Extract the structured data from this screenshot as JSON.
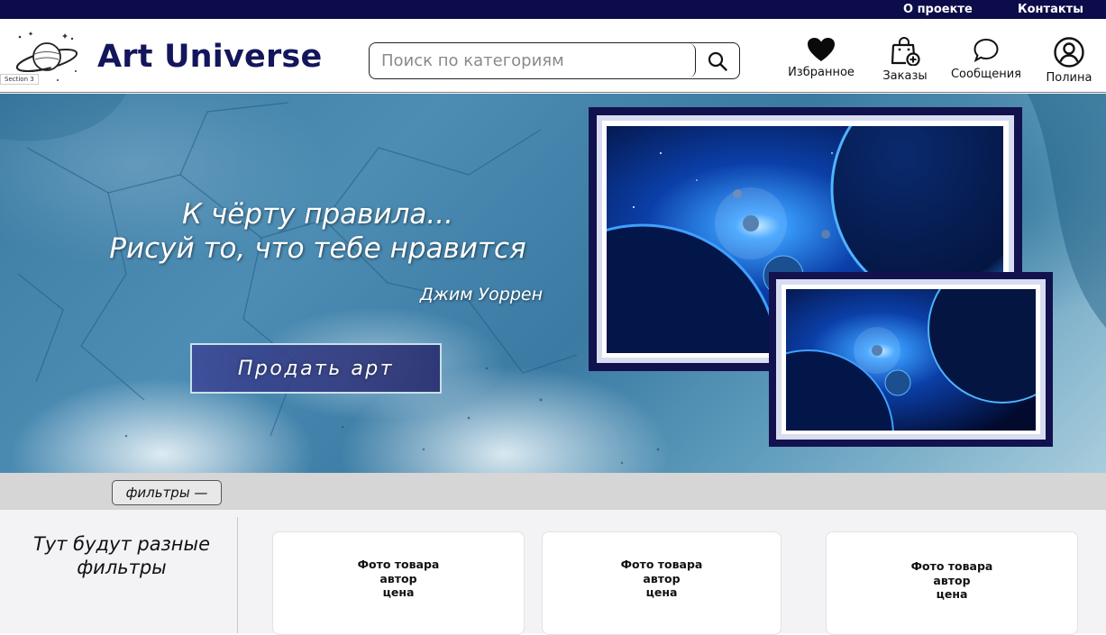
{
  "topbar": {
    "about_label": "О проекте",
    "contacts_label": "Контакты"
  },
  "header": {
    "brand": "Art Universe",
    "section_tag": "Section 3",
    "search_placeholder": "Поиск по категориям",
    "nav": {
      "favorites_label": "Избранное",
      "orders_label": "Заказы",
      "messages_label": "Сообщения",
      "profile_label": "Полина"
    }
  },
  "hero": {
    "quote_line1": "К чёрту правила...",
    "quote_line2": "Рисуй то, что тебе нравится",
    "quote_author": "Джим Уоррен",
    "sell_button_label": "Продать арт"
  },
  "filterbar": {
    "filters_button_label": "фильтры —"
  },
  "content": {
    "sidebar_note": "Тут будут разные фильтры",
    "cards": [
      {
        "photo": "Фото товара",
        "author": "автор",
        "price": "цена"
      },
      {
        "photo": "Фото товара",
        "author": "автор",
        "price": "цена"
      },
      {
        "photo": "Фото товара",
        "author": "автор",
        "price": "цена"
      }
    ]
  },
  "colors": {
    "navy": "#0c0c4a",
    "brand_text": "#14165c",
    "frame": "#12124e",
    "filterbar_bg": "#d6d6d6"
  },
  "icons": [
    "planet-logo-icon",
    "search-icon",
    "heart-icon",
    "shopping-bag-plus-icon",
    "chat-bubble-icon",
    "user-icon"
  ]
}
